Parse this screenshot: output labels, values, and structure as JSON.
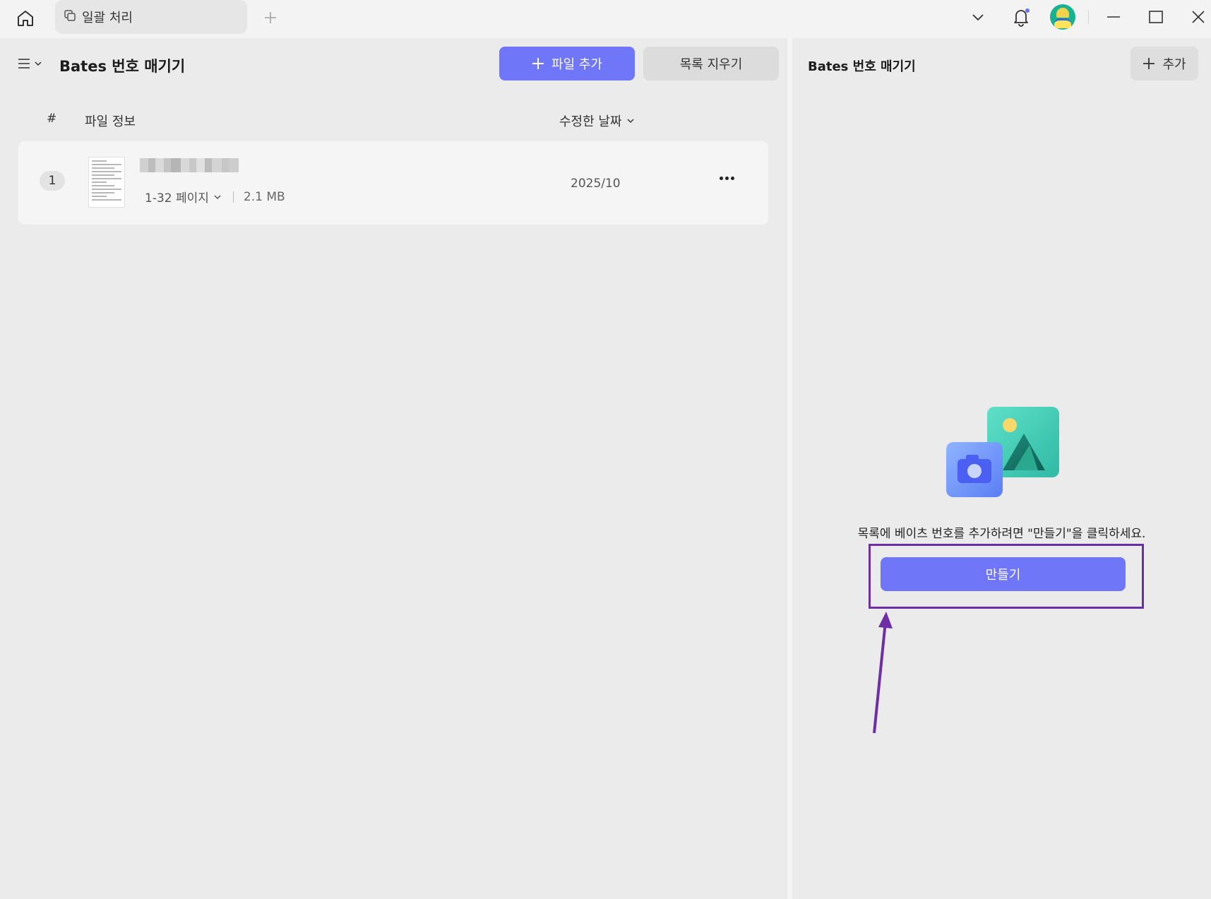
{
  "titlebar": {
    "tab_label": "일괄 처리",
    "icons": [
      "home-icon",
      "batch-icon",
      "plus-icon",
      "chevron-down-icon",
      "bell-icon",
      "avatar",
      "minimize-icon",
      "maximize-icon",
      "close-icon"
    ]
  },
  "left": {
    "title": "Bates 번호 매기기",
    "add_file_label": "파일 추가",
    "clear_list_label": "목록 지우기",
    "columns": {
      "index": "#",
      "info": "파일 정보",
      "date": "수정한 날짜"
    },
    "files": [
      {
        "index": "1",
        "pages": "1-32 페이지",
        "size": "2.1 MB",
        "modified": "2025/10"
      }
    ]
  },
  "right": {
    "title": "Bates 번호 매기기",
    "add_label": "추가",
    "empty_message": "목록에 베이츠 번호를 추가하려면 \"만들기\"을 클릭하세요.",
    "create_label": "만들기"
  },
  "colors": {
    "accent": "#6f76f7",
    "annotation": "#6e2ea5"
  }
}
